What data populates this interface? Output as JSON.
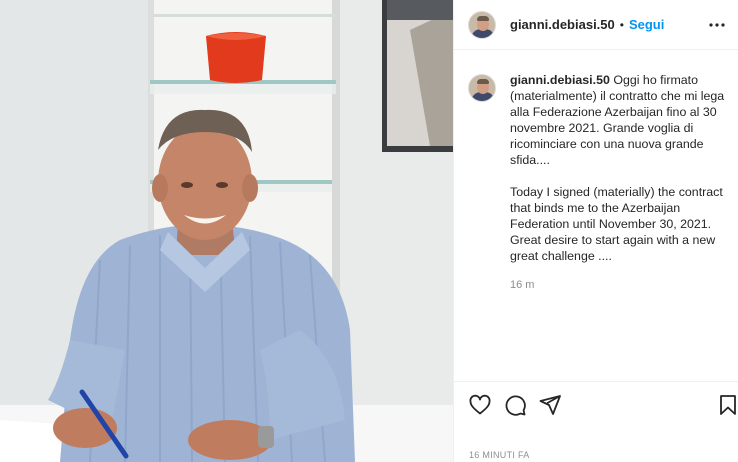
{
  "post": {
    "username": "gianni.debiasi.50",
    "separator": "•",
    "follow_label": "Segui",
    "more_icon": "more-horizontal-icon",
    "caption": {
      "username": "gianni.debiasi.50",
      "text": "Oggi ho firmato (materialmente) il contratto che mi lega alla Federazione Azerbaijan fino al 30 novembre 2021. Grande voglia di ricominciare con una nuova grande sfida....\n\nToday I signed (materially) the contract that binds me to the Azerbaijan Federation until November 30, 2021. Great desire to start again with a new great challenge ....",
      "time": "16 m"
    },
    "actions": {
      "like_icon": "heart-icon",
      "comment_icon": "comment-icon",
      "share_icon": "share-icon",
      "save_icon": "bookmark-icon"
    },
    "posted_ago": "16 MINUTI FA"
  },
  "colors": {
    "link_blue": "#0095f6",
    "text": "#262626",
    "muted": "#8e8e8e",
    "border": "#efefef"
  }
}
